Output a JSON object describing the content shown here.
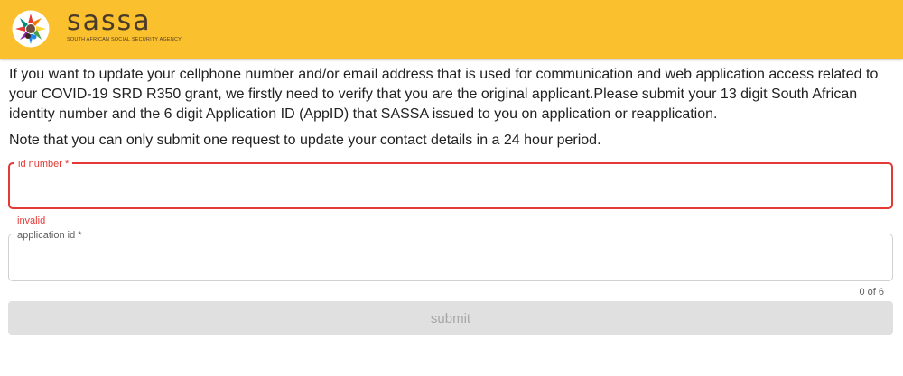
{
  "header": {
    "brand_name": "sassa",
    "brand_subtitle": "SOUTH AFRICAN SOCIAL SECURITY AGENCY",
    "background_color": "#fbc02d",
    "logo_icon": "sassa-hands-logo-icon"
  },
  "main": {
    "intro_text": "If you want to update your cellphone number and/or email address that is used for communication and web application access related to your COVID-19 SRD R350 grant, we firstly need to verify that you are the original applicant.Please submit your 13 digit South African identity number and the 6 digit Application ID (AppID) that SASSA issued to you on application or reapplication.",
    "note_text": "Note that you can only submit one request to update your contact details in a 24 hour period."
  },
  "form": {
    "id_number": {
      "label": "id number *",
      "value": "",
      "error": "invalid",
      "border_color": "#e53935"
    },
    "application_id": {
      "label": "application id *",
      "value": "",
      "counter": "0 of 6"
    },
    "submit_label": "submit"
  }
}
